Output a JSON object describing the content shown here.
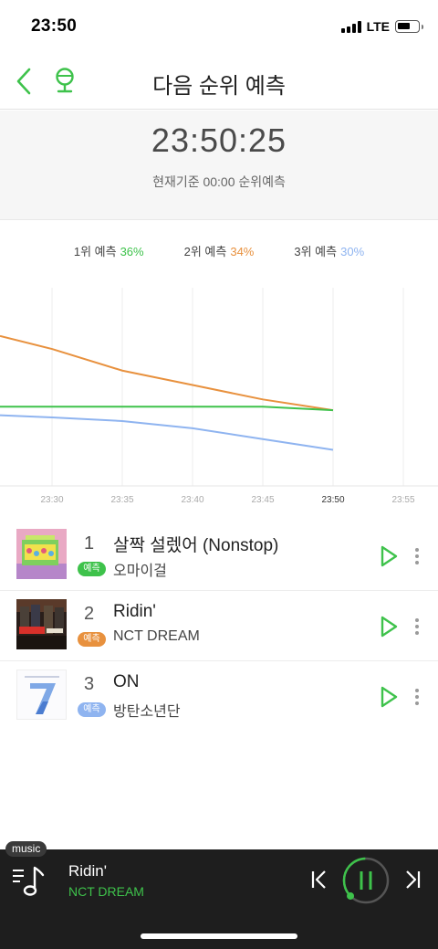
{
  "status_bar": {
    "time": "23:50",
    "network": "LTE"
  },
  "header": {
    "title": "다음 순위 예측",
    "back_icon": "chevron-left-icon",
    "mic_icon": "microphone-icon"
  },
  "countdown": {
    "time": "23:50:25",
    "subtitle": "현재기준 00:00 순위예측"
  },
  "legend": [
    {
      "label": "1위 예측",
      "value": "36%",
      "color": "#3ec24b"
    },
    {
      "label": "2위 예측",
      "value": "34%",
      "color": "#e8913e"
    },
    {
      "label": "3위 예측",
      "value": "30%",
      "color": "#8fb4f0"
    }
  ],
  "chart_data": {
    "type": "line",
    "x": [
      "23:30",
      "23:35",
      "23:40",
      "23:45",
      "23:50",
      "23:55"
    ],
    "highlight_tick": "23:50",
    "grid": true,
    "series": [
      {
        "color": "#e8913e",
        "values": [
          35.8,
          35.2,
          34.8,
          34.4,
          34.1,
          null
        ]
      },
      {
        "color": "#3ec24b",
        "values": [
          34.2,
          34.2,
          34.2,
          34.2,
          34.1,
          null
        ]
      },
      {
        "color": "#8fb4f0",
        "values": [
          33.9,
          33.8,
          33.6,
          33.3,
          33.0,
          null
        ]
      }
    ]
  },
  "rankings": [
    {
      "rank": "1",
      "title": "살짝 설렜어 (Nonstop)",
      "artist": "오마이걸",
      "badge": "예측",
      "badge_color": "#3ec24b"
    },
    {
      "rank": "2",
      "title": "Ridin'",
      "artist": "NCT DREAM",
      "badge": "예측",
      "badge_color": "#e8913e"
    },
    {
      "rank": "3",
      "title": "ON",
      "artist": "방탄소년단",
      "badge": "예측",
      "badge_color": "#8fb4f0"
    }
  ],
  "player": {
    "tag": "music",
    "title": "Ridin'",
    "artist": "NCT DREAM",
    "progress": 0.35
  }
}
